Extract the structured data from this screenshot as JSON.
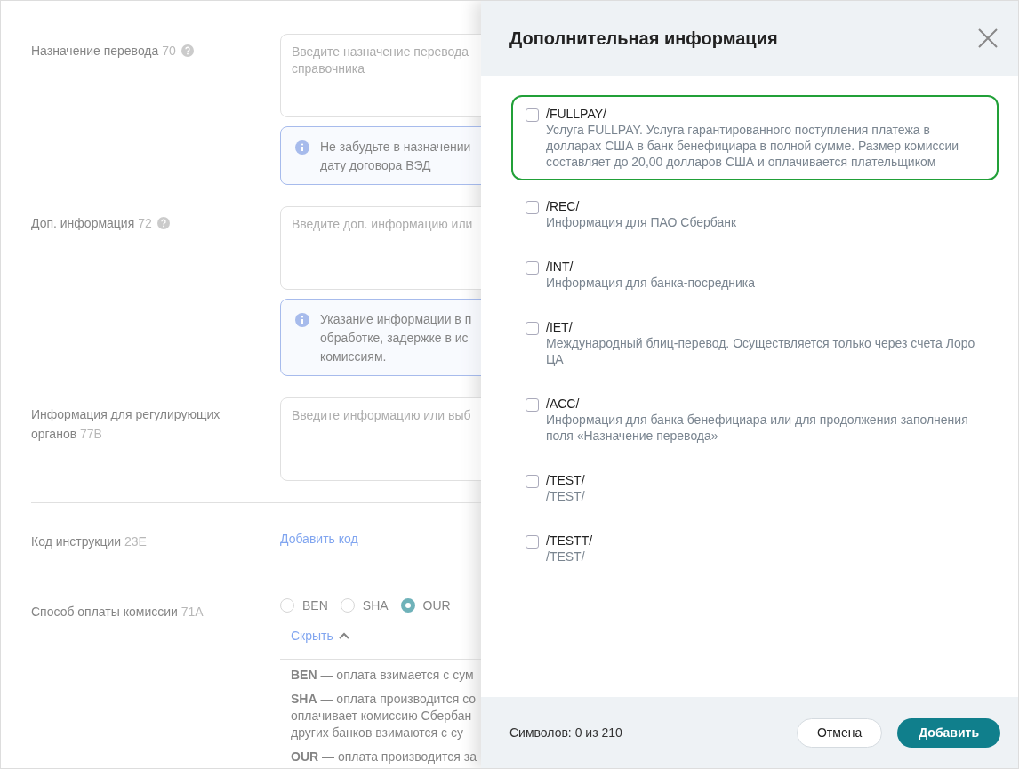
{
  "form": {
    "rows": [
      {
        "kind": "textarea",
        "label": "Назначение перевода",
        "code": "70",
        "help": true,
        "placeholder": "Введите назначение перевода справочника",
        "info": [
          "Не забудьте в назначении",
          "дату договора ВЭД"
        ]
      },
      {
        "kind": "textarea",
        "label": "Доп. информация",
        "code": "72",
        "help": true,
        "placeholder": "Введите доп. информацию или",
        "info": [
          "Указание информации в п",
          "обработке, задержке в ис",
          "комиссиям."
        ]
      },
      {
        "kind": "textarea",
        "label": "Информация для регулирующих органов",
        "code": "77B",
        "help": false,
        "placeholder": "Введите информацию или выб"
      },
      {
        "kind": "link",
        "label": "Код инструкции",
        "code": "23E",
        "link": "Добавить код"
      },
      {
        "kind": "radio",
        "label": "Способ оплаты комиссии",
        "code": "71A",
        "options": [
          {
            "label": "BEN",
            "selected": false
          },
          {
            "label": "SHA",
            "selected": false
          },
          {
            "label": "OUR",
            "selected": true
          }
        ],
        "toggle": "Скрыть",
        "expanded": true,
        "notes": [
          [
            "**BEN** — оплата взимается с сум"
          ],
          [
            "**SHA** — оплата производится со",
            "оплачивает комиссию Сбербан",
            "других банков взимаются с су"
          ],
          [
            "**OUR** — оплата производится за"
          ]
        ]
      }
    ]
  },
  "drawer": {
    "title": "Дополнительная информация",
    "items": [
      {
        "code": "/FULLPAY/",
        "description": "Услуга FULLPAY. Услуга гарантированного поступления платежа в долларах США в банк бенефициара в полной сумме. Размер комиссии составляет до 20,00 долларов США и оплачивается плательщиком",
        "checked": false,
        "highlighted": true
      },
      {
        "code": "/REC/",
        "description": "Информация для ПАО Сбербанк",
        "checked": false,
        "highlighted": false
      },
      {
        "code": "/INT/",
        "description": "Информация для банка-посредника",
        "checked": false,
        "highlighted": false
      },
      {
        "code": "/IET/",
        "description": "Международный блиц-перевод. Осуществляется только через счета Лоро ЦА",
        "checked": false,
        "highlighted": false
      },
      {
        "code": "/ACC/",
        "description": "Информация для банка бенефициара или для продолжения заполнения поля «Назначение перевода»",
        "checked": false,
        "highlighted": false
      },
      {
        "code": "/TEST/",
        "description": "/TEST/",
        "checked": false,
        "highlighted": false
      },
      {
        "code": "/TESTT/",
        "description": "/TEST/",
        "checked": false,
        "highlighted": false
      }
    ],
    "counter": "Символов: 0 из 210",
    "buttons": [
      {
        "kind": "secondary",
        "label": "Отмена"
      },
      {
        "kind": "primary",
        "label": "Добавить"
      }
    ]
  }
}
